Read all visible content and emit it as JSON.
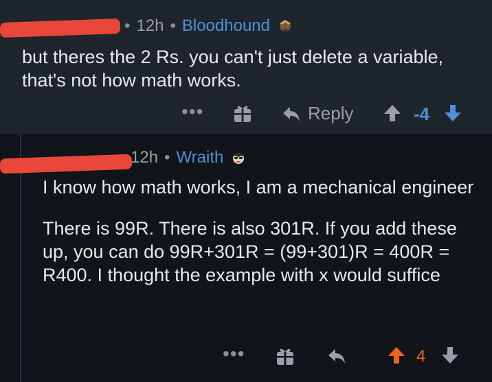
{
  "comments": [
    {
      "age": "12h",
      "flair": "Bloodhound",
      "body": [
        "but theres the 2 Rs. you can't just delete a variable, that's not how math works."
      ],
      "actions": {
        "more": "•••",
        "reply": "Reply",
        "score": "-4"
      },
      "vote_state": "downvoted"
    },
    {
      "age": "12h",
      "flair": "Wraith",
      "body": [
        "I know how math works, I am a mechanical engineer",
        "There is 99R. There is also 301R. If you add these up, you can do 99R+301R = (99+301)R = 400R = R400. I thought the example with x would suffice"
      ],
      "actions": {
        "more": "•••",
        "score": "4"
      },
      "vote_state": "upvoted"
    }
  ],
  "separator": "•",
  "colors": {
    "flair": "#4f8fd7",
    "downvote": "#4f8fd7",
    "upvote": "#f0631e",
    "redaction": "#e8473a"
  }
}
